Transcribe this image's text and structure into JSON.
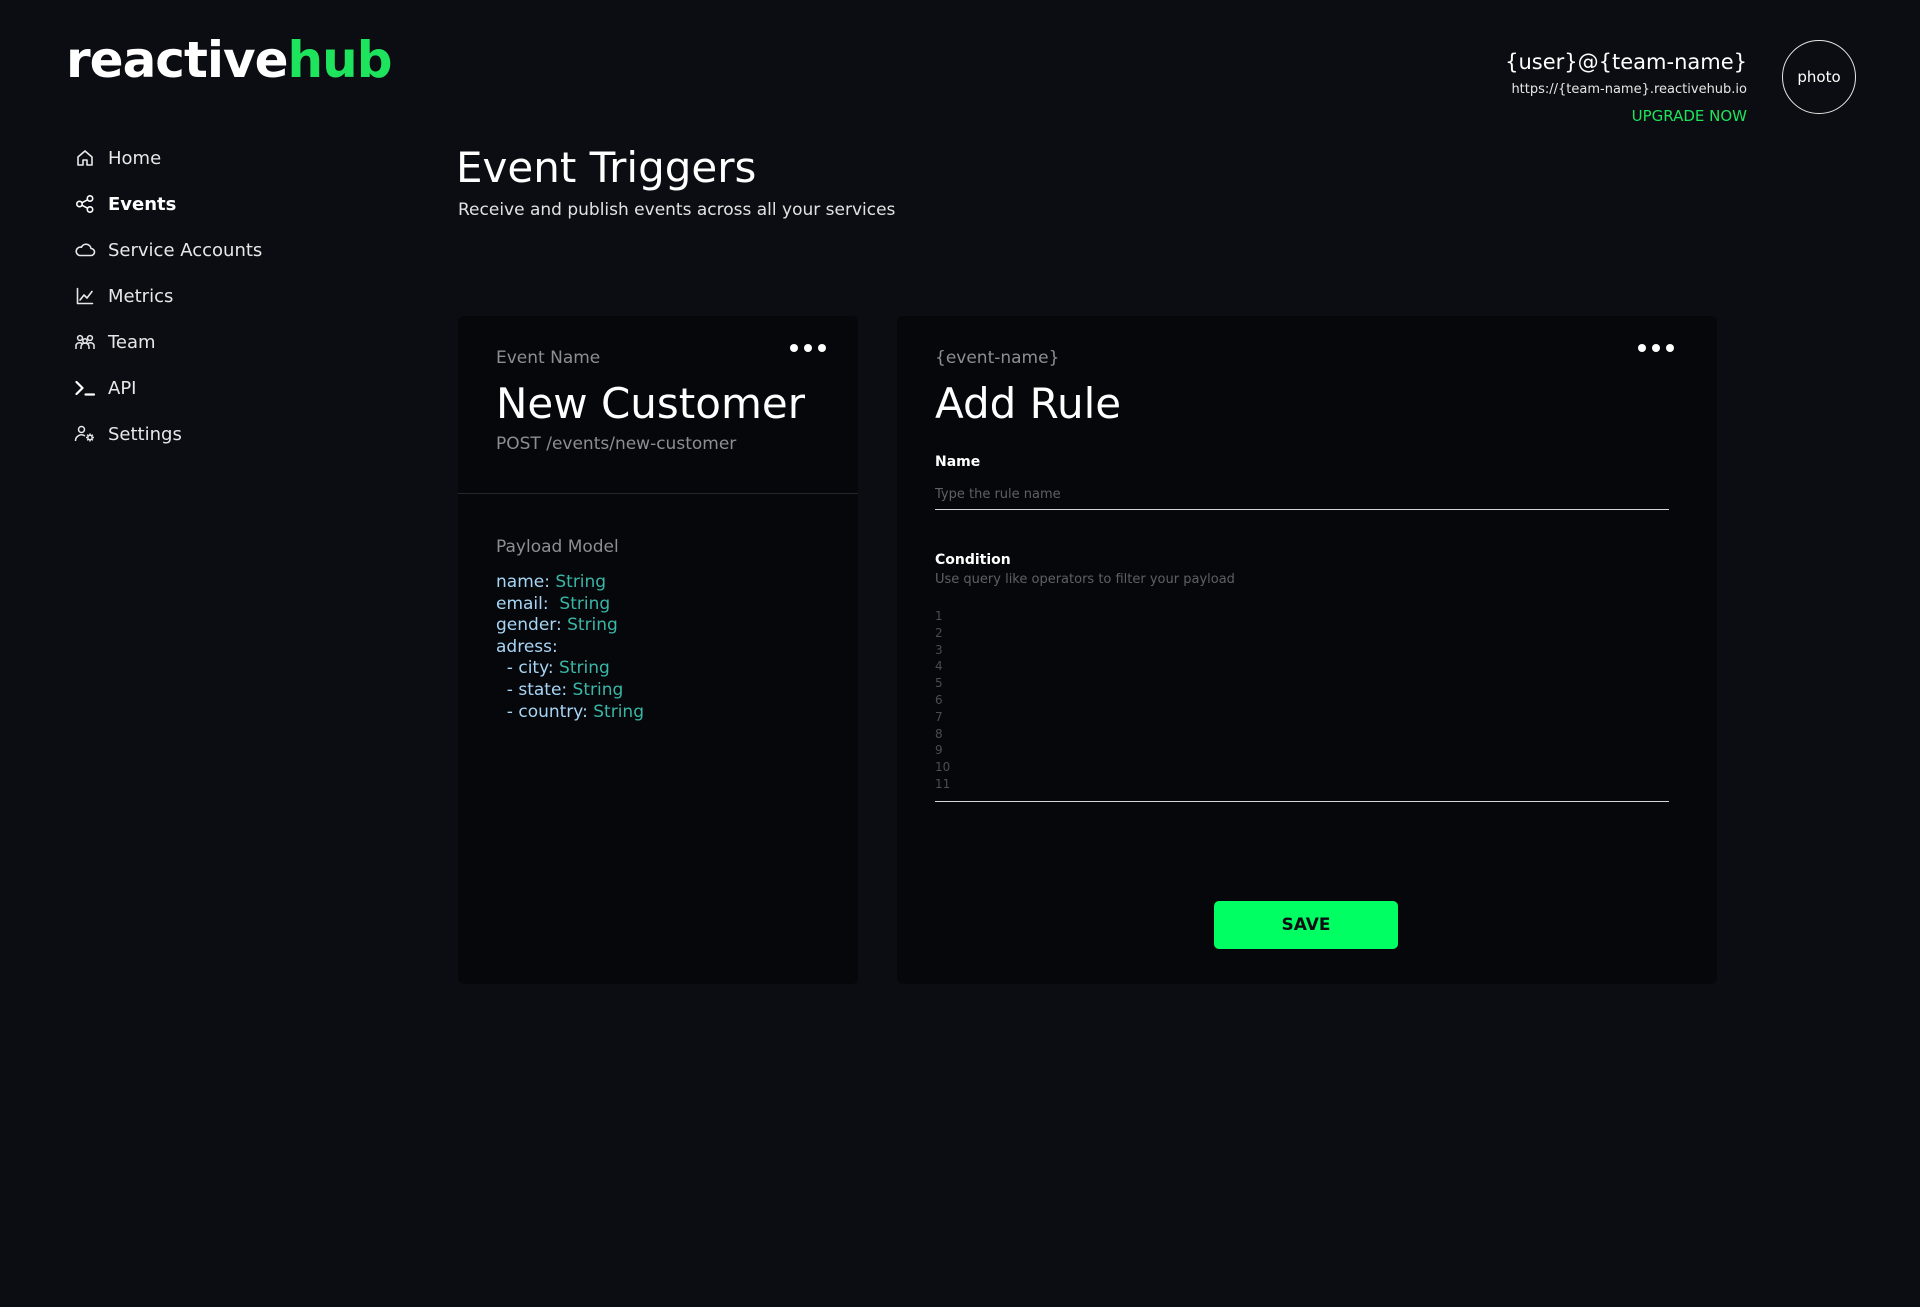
{
  "brand": {
    "part_a": "reactive",
    "part_b": "hub",
    "accent_color": "#1ee35c"
  },
  "sidebar": {
    "items": [
      {
        "label": "Home",
        "icon": "home-icon",
        "active": false
      },
      {
        "label": "Events",
        "icon": "share-nodes-icon",
        "active": true
      },
      {
        "label": "Service Accounts",
        "icon": "cloud-icon",
        "active": false
      },
      {
        "label": "Metrics",
        "icon": "chart-line-icon",
        "active": false
      },
      {
        "label": "Team",
        "icon": "team-icon",
        "active": false
      },
      {
        "label": "API",
        "icon": "terminal-icon",
        "active": false
      },
      {
        "label": "Settings",
        "icon": "user-gear-icon",
        "active": false
      }
    ]
  },
  "user": {
    "name": "{user}@{team-name}",
    "url": "https://{team-name}.reactivehub.io",
    "upgrade_label": "UPGRADE NOW",
    "avatar_label": "photo"
  },
  "page": {
    "title": "Event Triggers",
    "subtitle": "Receive and publish events across all your services"
  },
  "event_card": {
    "label": "Event Name",
    "name": "New Customer",
    "endpoint": "POST /events/new-customer",
    "payload_title": "Payload Model",
    "payload": [
      {
        "key": "name:",
        "value": "String"
      },
      {
        "key": "email:",
        "value": " String"
      },
      {
        "key": "gender:",
        "value": "String"
      },
      {
        "key": "adress:",
        "value": ""
      },
      {
        "key": "  - city:",
        "value": "String"
      },
      {
        "key": "  - state:",
        "value": "String"
      },
      {
        "key": "  - country:",
        "value": "String"
      }
    ],
    "key_color": "#a7d5f5",
    "value_color": "#3ab6a6"
  },
  "rule_card": {
    "label": "{event-name}",
    "title": "Add Rule",
    "name_label": "Name",
    "name_placeholder": "Type the rule name",
    "name_value": "",
    "condition_label": "Condition",
    "condition_help": "Use query like operators to filter your payload",
    "line_numbers": [
      "1",
      "2",
      "3",
      "4",
      "5",
      "6",
      "7",
      "8",
      "9",
      "10",
      "11"
    ],
    "save_label": "SAVE",
    "save_color": "#00ff62"
  }
}
